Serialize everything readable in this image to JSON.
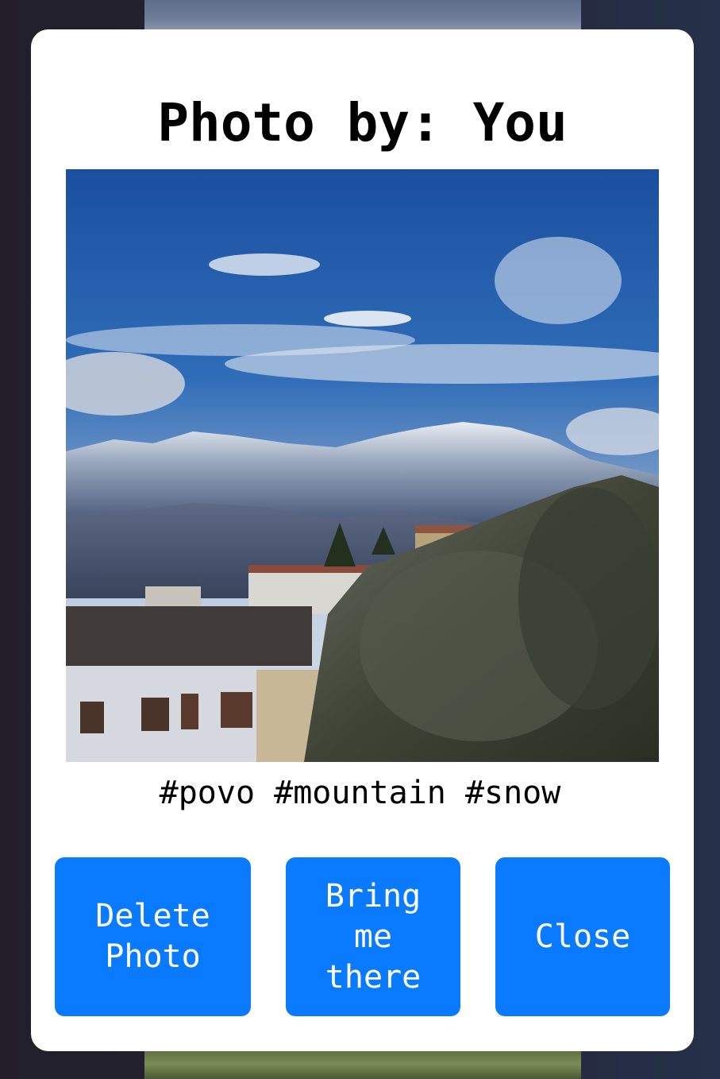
{
  "modal": {
    "title": "Photo by: You",
    "tags": "#povo #mountain #snow"
  },
  "buttons": {
    "delete": "Delete Photo",
    "bring": "Bring me there",
    "close": "Close"
  },
  "colors": {
    "button_bg": "#0a7bff",
    "button_text": "#ffffff",
    "modal_bg": "#ffffff",
    "backdrop": "#242433"
  }
}
